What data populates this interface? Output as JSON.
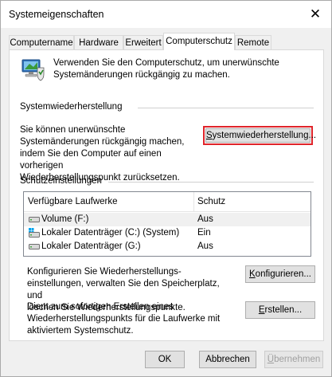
{
  "window": {
    "title": "Systemeigenschaften",
    "close_glyph": "✕"
  },
  "tabs": [
    {
      "label": "Computername"
    },
    {
      "label": "Hardware"
    },
    {
      "label": "Erweitert"
    },
    {
      "label": "Computerschutz",
      "active": true
    },
    {
      "label": "Remote"
    }
  ],
  "intro": {
    "line1": "Verwenden Sie den Computerschutz, um unerwünschte",
    "line2": "Systemänderungen rückgängig zu machen."
  },
  "restore_section": {
    "heading": "Systemwiederherstellung",
    "desc_lines": [
      "Sie können unerwünschte",
      "Systemänderungen rückgängig machen,",
      "indem Sie den Computer auf einen vorherigen",
      "Wiederherstellungspunkt zurücksetzen."
    ],
    "button_first": "S",
    "button_rest": "ystemwiederherstellung...",
    "highlight_color": "#e0242a"
  },
  "protection": {
    "heading": "Schutzeinstellungen",
    "columns": [
      "Verfügbare Laufwerke",
      "Schutz"
    ],
    "rows": [
      {
        "drive": "Volume (F:)",
        "status": "Aus",
        "icon": "drive-icon"
      },
      {
        "drive": "Lokaler Datenträger (C:) (System)",
        "status": "Ein",
        "icon": "system-drive-icon"
      },
      {
        "drive": "Lokaler Datenträger (G:)",
        "status": "Aus",
        "icon": "drive-icon"
      }
    ]
  },
  "configure": {
    "desc_lines": [
      "Konfigurieren Sie Wiederherstellungs-",
      "einstellungen, verwalten Sie den Speicherplatz, und",
      "löschen Sie Wiederherstellungspunkte."
    ],
    "button_first": "K",
    "button_rest": "onfigurieren..."
  },
  "create": {
    "desc_lines": [
      "Dient zum sofortigen Erstellen eines",
      "Wiederherstellungspunkts für die Laufwerke mit",
      "aktiviertem Systemschutz."
    ],
    "button_first": "E",
    "button_rest": "rstellen..."
  },
  "footer": {
    "ok": "OK",
    "cancel": "Abbrechen",
    "apply_first": "Ü",
    "apply_rest": "bernehmen"
  }
}
